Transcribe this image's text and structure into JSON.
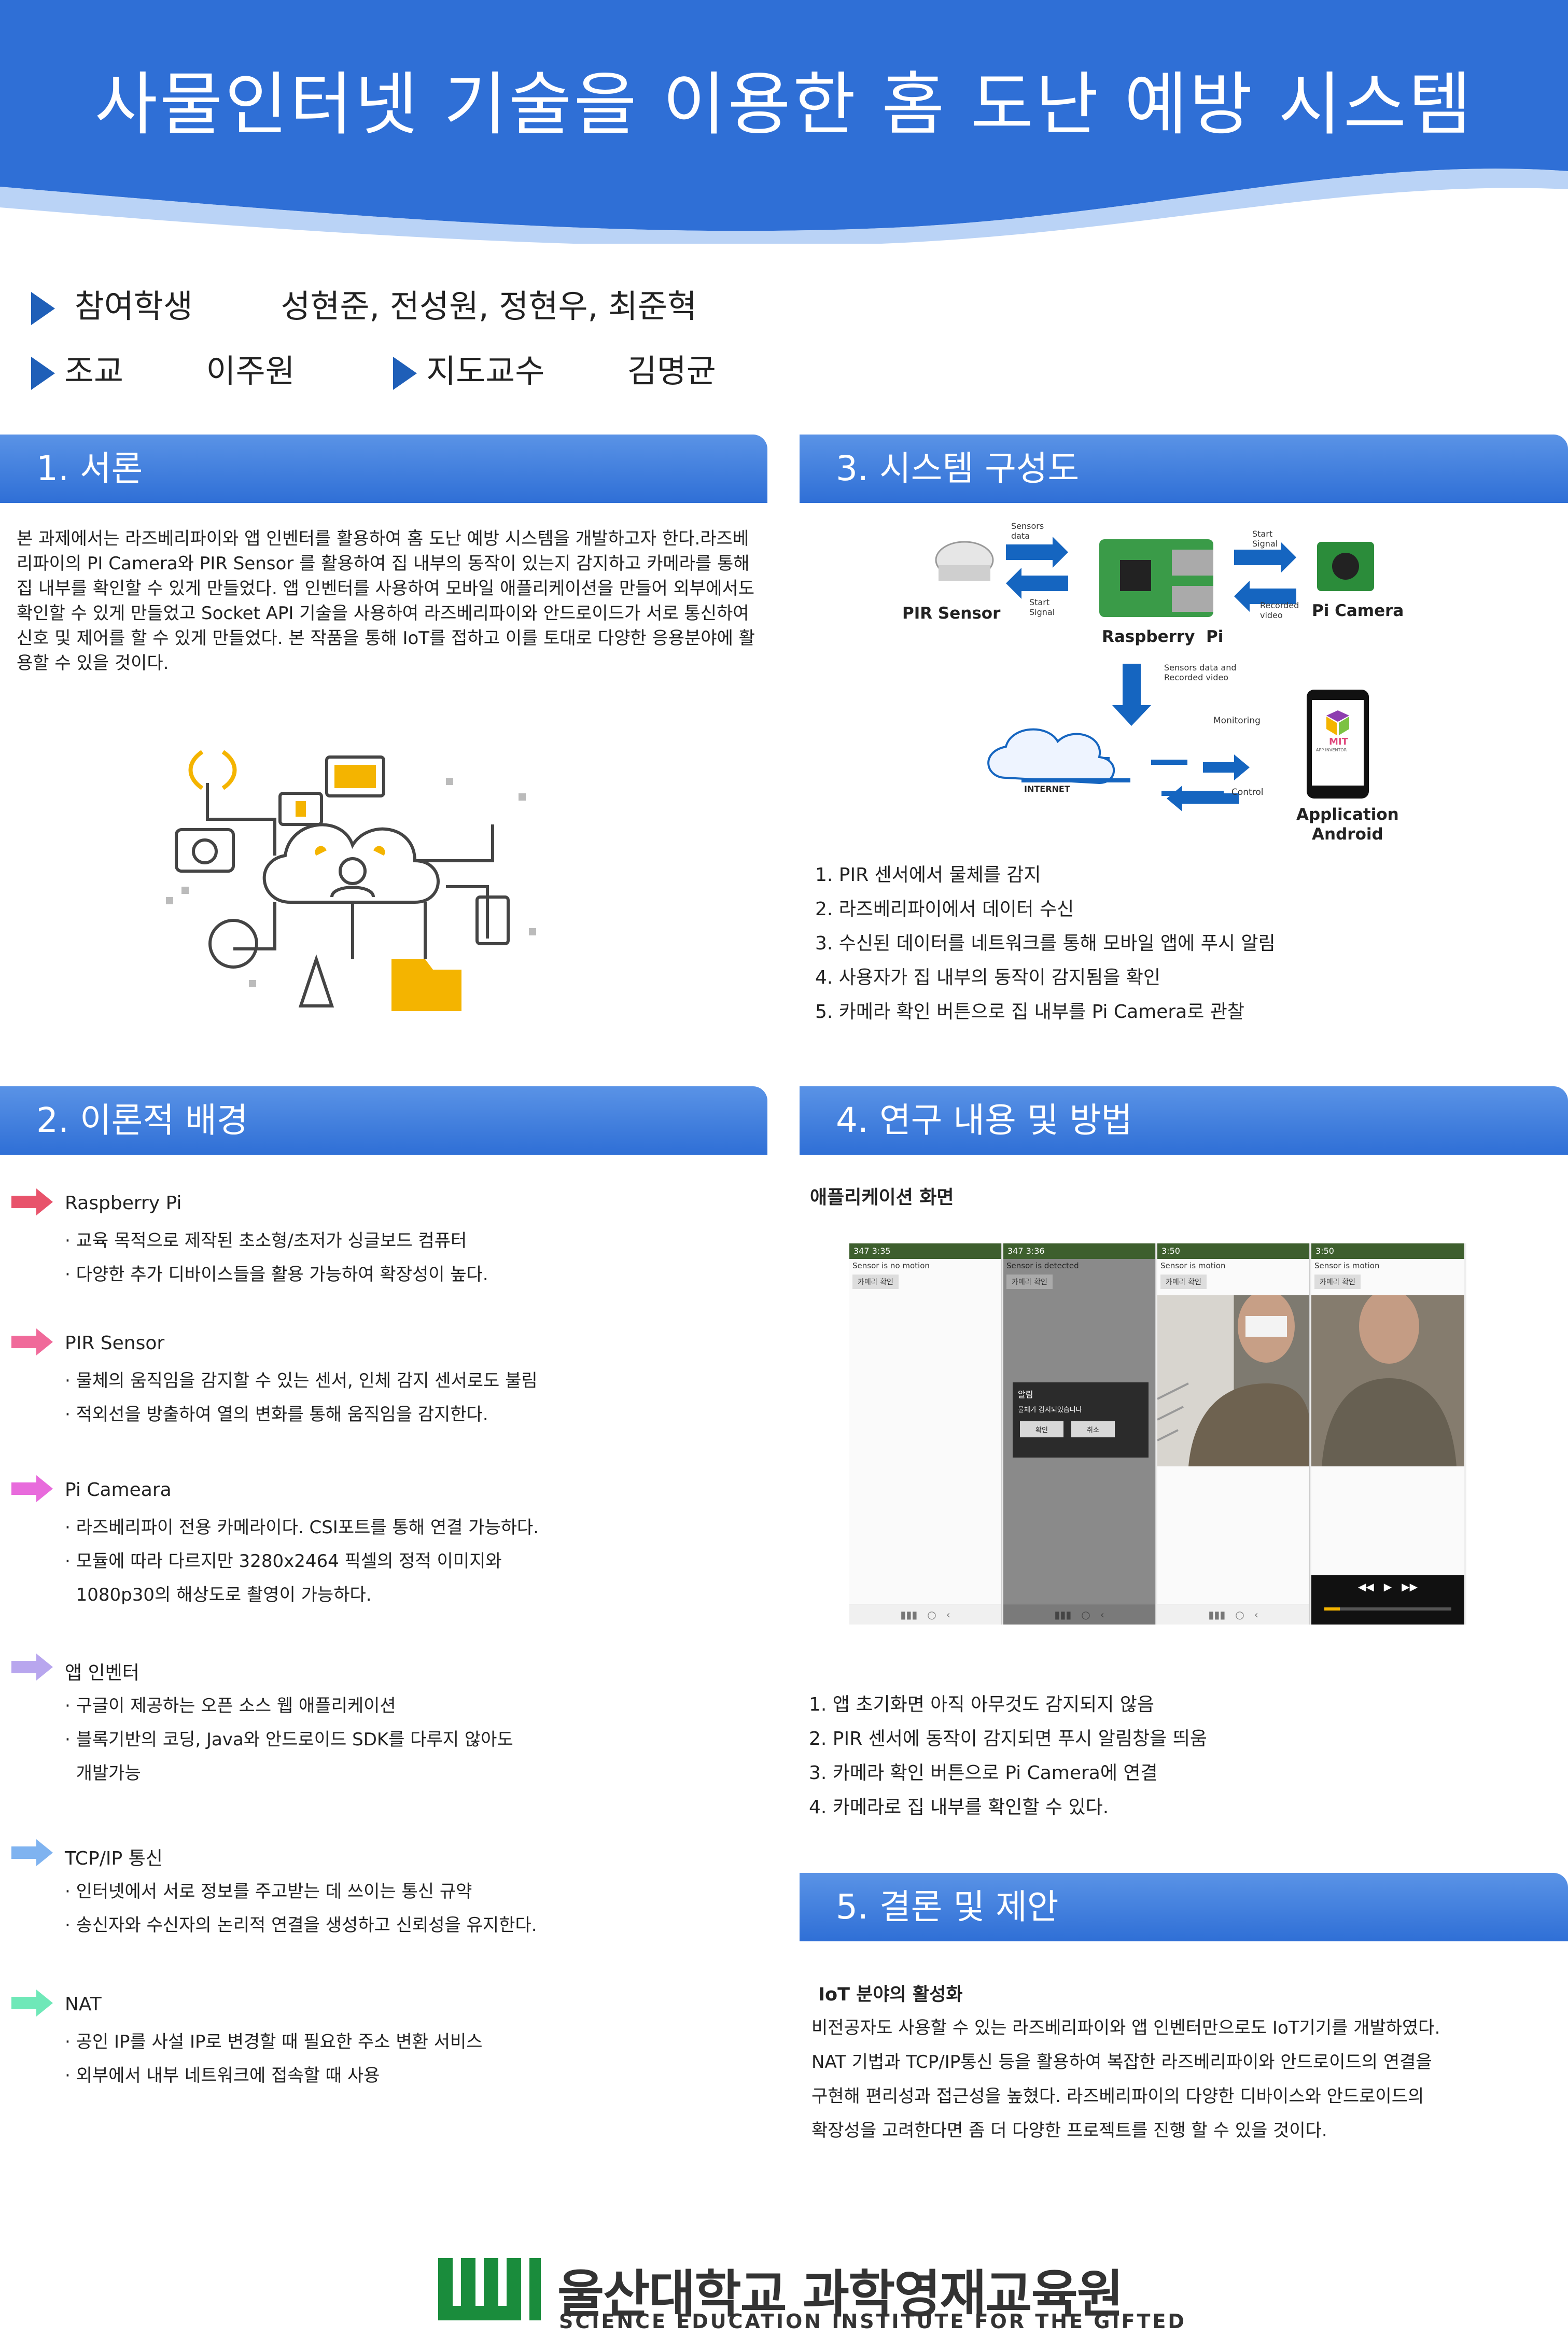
{
  "title": "사물인터넷 기술을 이용한 홈 도난  예방 시스템",
  "participants": {
    "students_label": "참여학생",
    "students": "성현준, 전성원, 정현우, 최준혁",
    "ta_label": "조교",
    "ta": "이주원",
    "advisor_label": "지도교수",
    "advisor": "김명균"
  },
  "sections": {
    "intro": {
      "heading": "1. 서론",
      "text": " 본 과제에서는 라즈베리파이와 앱 인벤터를 활용하여 홈 도난 예방 시스템을 개발하고자 한다.라즈베리파이의 PI Camera와 PIR Sensor 를 활용하여 집 내부의 동작이 있는지 감지하고 카메라를 통해 집 내부를 확인할 수 있게 만들었다. 앱 인벤터를 사용하여 모바일 애플리케이션을 만들어 외부에서도 확인할 수 있게 만들었고 Socket API 기술을 사용하여 라즈베리파이와 안드로이드가 서로 통신하여 신호 및 제어를 할 수 있게 만들었다. 본 작품을 통해 IoT를 접하고 이를 토대로 다양한 응용분야에 활용할 수 있을 것이다."
    },
    "background": {
      "heading": "2. 이론적 배경",
      "items": [
        {
          "title": "Raspberry Pi",
          "color": "#e8536b",
          "lines": [
            "· 교육 목적으로 제작된 초소형/초저가 싱글보드 컴퓨터",
            "· 다양한 추가 디바이스들을 활용 가능하여 확장성이 높다."
          ]
        },
        {
          "title": "PIR Sensor",
          "color": "#f06a9a",
          "lines": [
            "· 물체의 움직임을 감지할 수 있는 센서, 인체 감지 센서로도 불림",
            "· 적외선을 방출하여 열의 변화를 통해 움직임을 감지한다."
          ]
        },
        {
          "title": "Pi Cameara",
          "color": "#e86bdc",
          "lines": [
            "· 라즈베리파이 전용 카메라이다. CSI포트를 통해 연결 가능하다.",
            "· 모듈에 따라 다르지만 3280x2464 픽셀의 정적 이미지와",
            "  1080p30의 해상도로 촬영이 가능하다."
          ]
        },
        {
          "title": "앱 인벤터",
          "color": "#b8a6ee",
          "lines": [
            "· 구글이 제공하는 오픈 소스 웹 애플리케이션",
            "· 블록기반의 코딩, Java와 안드로이드 SDK를 다루지 않아도",
            "  개발가능"
          ]
        },
        {
          "title": "TCP/IP 통신",
          "color": "#7fb3f0",
          "lines": [
            "· 인터넷에서 서로 정보를 주고받는 데 쓰이는 통신 규약",
            "· 송신자와 수신자의 논리적 연결을 생성하고 신뢰성을 유지한다."
          ]
        },
        {
          "title": "NAT",
          "color": "#6fe8b8",
          "lines": [
            "· 공인 IP를 사설 IP로 변경할 때 필요한 주소 변환 서비스",
            "· 외부에서 내부 네트워크에 접속할 때 사용"
          ]
        }
      ]
    },
    "system": {
      "heading": "3. 시스템 구성도",
      "diagram": {
        "pir": "PIR Sensor",
        "rpi": "Raspberry  Pi",
        "picam": "Pi Camera",
        "internet": "INTERNET",
        "app": "Application\nAndroid",
        "sensors_data": "Sensors\ndata",
        "start_signal_left": "Start\nSignal",
        "start_signal_right": "Start\nSignal",
        "recorded_video": "Recorded\nvideo",
        "sensors_and_video": "Sensors data and\nRecorded video",
        "monitoring": "Monitoring",
        "control": "Control",
        "mit_label": "MIT",
        "mit_sub": "APP INVENTOR"
      },
      "steps": [
        "1.  PIR 센서에서 물체를 감지",
        "2.  라즈베리파이에서 데이터 수신",
        "3.  수신된 데이터를 네트워크를 통해 모바일 앱에 푸시 알림",
        "4.  사용자가 집 내부의 동작이 감지됨을 확인",
        "5.  카메라 확인 버튼으로 집 내부를 Pi Camera로 관찰"
      ]
    },
    "research": {
      "heading": "4. 연구 내용 및 방법",
      "subheading": "애플리케이션 화면",
      "screens": [
        {
          "status": "347 3:35",
          "message": "Sensor is no motion",
          "button": "카메라 확인"
        },
        {
          "status": "347 3:36",
          "message": "Sensor is detected",
          "button": "카메라 확인",
          "dialog_title": "알림",
          "dialog_text": "물체가 감지되었습니다",
          "ok": "확인",
          "cancel": "취소"
        },
        {
          "status": "3:50",
          "message": "Sensor is motion",
          "button": "카메라 확인"
        },
        {
          "status": "3:50",
          "message": "Sensor is motion",
          "button": "카메라 확인"
        }
      ],
      "steps": [
        "1.  앱 초기화면 아직 아무것도 감지되지 않음",
        "2.  PIR 센서에 동작이 감지되면 푸시 알림창을 띄움",
        "3.  카메라 확인 버튼으로 Pi Camera에 연결",
        "4.  카메라로 집 내부를 확인할 수 있다."
      ]
    },
    "conclusion": {
      "heading": "5. 결론 및 제안",
      "subheading": "IoT 분야의 활성화",
      "lines": [
        "비전공자도 사용할 수 있는 라즈베리파이와 앱 인벤터만으로도 IoT기기를 개발하였다.",
        "NAT 기법과 TCP/IP통신 등을 활용하여 복잡한 라즈베리파이와 안드로이드의 연결을",
        "구현해 편리성과 접근성을 높혔다. 라즈베리파이의 다양한 디바이스와 안드로이드의",
        "확장성을 고려한다면 좀 더 다양한 프로젝트를 진행 할 수 있을 것이다."
      ]
    }
  },
  "footer": {
    "name_ko": "울산대학교 과학영재교육원",
    "name_en": "SCIENCE EDUCATION INSTITUTE FOR THE GIFTED"
  },
  "colors": {
    "primary": "#2f6fd6",
    "bar_light": "#5a93e6",
    "logo_green": "#1a8c3c",
    "arrow_blue": "#1565c0"
  }
}
